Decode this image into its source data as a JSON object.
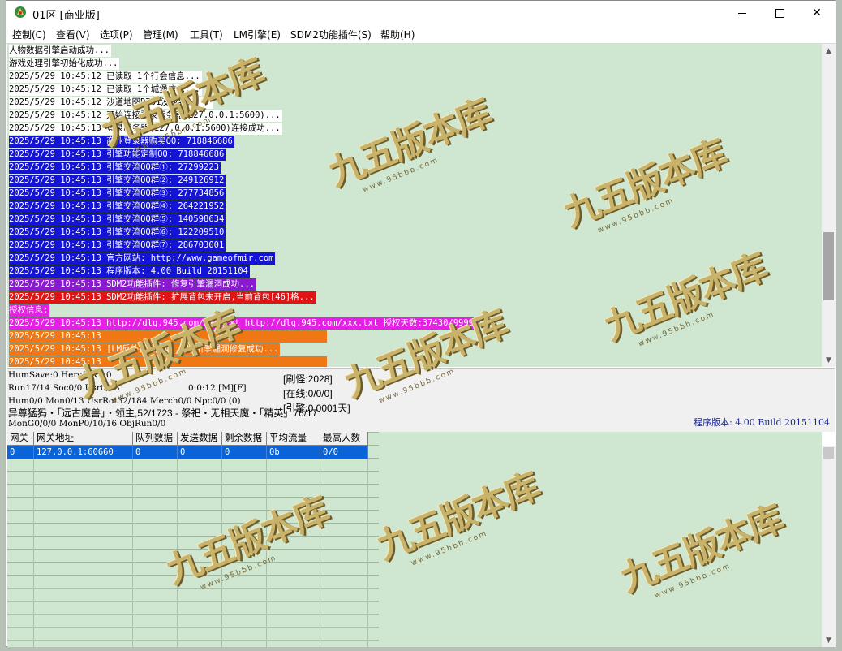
{
  "window": {
    "title": "01区 [商业版]",
    "controls": {
      "minimize": "",
      "maximize": "",
      "close": "✕"
    }
  },
  "menu": [
    "控制(C)",
    "查看(V)",
    "选项(P)",
    "管理(M)",
    "工具(T)",
    "LM引擎(E)",
    "SDM2功能插件(S)",
    "帮助(H)"
  ],
  "log": [
    {
      "text": "人物数据引擎启动成功...",
      "bg": "#ffffff",
      "fg": "#000000"
    },
    {
      "text": "游戏处理引擎初始化成功...",
      "bg": "#ffffff",
      "fg": "#000000"
    },
    {
      "text": "2025/5/29 10:45:12 已读取 1个行会信息...",
      "bg": "#ffffff",
      "fg": "#000000"
    },
    {
      "text": "2025/5/29 10:45:12 已读取 1个城堡信息...",
      "bg": "#ffffff",
      "fg": "#000000"
    },
    {
      "text": "2025/5/29 10:45:12 沙道地图D701没找到！！！",
      "bg": "#ffffff",
      "fg": "#000000"
    },
    {
      "text": "2025/5/29 10:45:12 开始连接登录服务器(127.0.0.1:5600)...",
      "bg": "#ffffff",
      "fg": "#000000"
    },
    {
      "text": "2025/5/29 10:45:13 登录服务器(127.0.0.1:5600)连接成功...",
      "bg": "#ffffff",
      "fg": "#000000"
    },
    {
      "text": "2025/5/29 10:45:13 商业登录器购买QQ: 718846686",
      "bg": "#1414d6",
      "fg": "#ffffff"
    },
    {
      "text": "2025/5/29 10:45:13 引擎功能定制QQ: 718846686",
      "bg": "#1414d6",
      "fg": "#ffffff"
    },
    {
      "text": "2025/5/29 10:45:13 引擎交流QQ群①: 27299223",
      "bg": "#1414d6",
      "fg": "#ffffff"
    },
    {
      "text": "2025/5/29 10:45:13 引擎交流QQ群②: 249126912",
      "bg": "#1414d6",
      "fg": "#ffffff"
    },
    {
      "text": "2025/5/29 10:45:13 引擎交流QQ群③: 277734856",
      "bg": "#1414d6",
      "fg": "#ffffff"
    },
    {
      "text": "2025/5/29 10:45:13 引擎交流QQ群④: 264221952",
      "bg": "#1414d6",
      "fg": "#ffffff"
    },
    {
      "text": "2025/5/29 10:45:13 引擎交流QQ群⑤: 140598634",
      "bg": "#1414d6",
      "fg": "#ffffff"
    },
    {
      "text": "2025/5/29 10:45:13 引擎交流QQ群⑥: 122209510",
      "bg": "#1414d6",
      "fg": "#ffffff"
    },
    {
      "text": "2025/5/29 10:45:13 引擎交流QQ群⑦: 286703001",
      "bg": "#1414d6",
      "fg": "#ffffff"
    },
    {
      "text": "2025/5/29 10:45:13 官方网站: http://www.gameofmir.com",
      "bg": "#1414d6",
      "fg": "#ffffff"
    },
    {
      "text": "2025/5/29 10:45:13 程序版本: 4.00 Build 20151104",
      "bg": "#1414d6",
      "fg": "#ffffff"
    },
    {
      "text": "2025/5/29 10:45:13 SDM2功能插件: 修复引擎漏洞成功...",
      "bg": "#8a1ad0",
      "fg": "#ffffff"
    },
    {
      "text": "2025/5/29 10:45:13 SDM2功能插件: 扩展背包未开启,当前背包[46]格...",
      "bg": "#e01414",
      "fg": "#ffffff"
    },
    {
      "text": "授权信息:",
      "bg": "#e61ee6",
      "fg": "#ffffff"
    },
    {
      "text": "2025/5/29 10:45:13 http://dlq.945.com/xxx.txt http://dlq.945.com/xxx.txt 授权天数:37430/99999",
      "bg": "#e61ee6",
      "fg": "#ffffff"
    },
    {
      "text": "2025/5/29 10:45:13",
      "bg": "#f07814",
      "fg": "#ffffff",
      "pad": 390
    },
    {
      "text": "2025/5/29 10:45:13 [LM反外挂引擎v3.6]:引擎漏洞修复成功...",
      "bg": "#f07814",
      "fg": "#ffffff"
    },
    {
      "text": "2025/5/29 10:45:13",
      "bg": "#f07814",
      "fg": "#ffffff",
      "pad": 390
    }
  ],
  "status": {
    "line1": "HumSave:0 HeroSave:0",
    "line2": "Run17/14 Soc0/0 Usr0/13",
    "timer": "0:0:12 [M][F]",
    "line3": "Hum0/0 Mon0/13 UsrRot32/184 Merch0/0 Npc0/0 (0)",
    "line4": "异尊猛犸・「远古魔兽」・领主,52/1723 - 祭祀・无相天魔・「精英」76/17",
    "line5": "MonG0/0/0 MonP0/10/16 ObjRun0/0",
    "refresh": "[刷怪:2028]",
    "online": "[在线:0/0/0]",
    "engine": "[引擎:0.0001天]",
    "version": "程序版本: 4.00 Build 20151104"
  },
  "gateway": {
    "columns": [
      "网关",
      "网关地址",
      "队列数据",
      "发送数据",
      "剩余数据",
      "平均流量",
      "最高人数"
    ],
    "rows": [
      [
        "0",
        "127.0.0.1:60660",
        "0",
        "0",
        "0",
        "0b",
        "0/0"
      ]
    ]
  },
  "watermark": {
    "main": "九五版本库",
    "sub": "www.95bbb.com"
  },
  "colors": {
    "log_bg": "#cfe6d0",
    "selection": "#0a64d8",
    "accent_version": "#1e2a8a"
  }
}
